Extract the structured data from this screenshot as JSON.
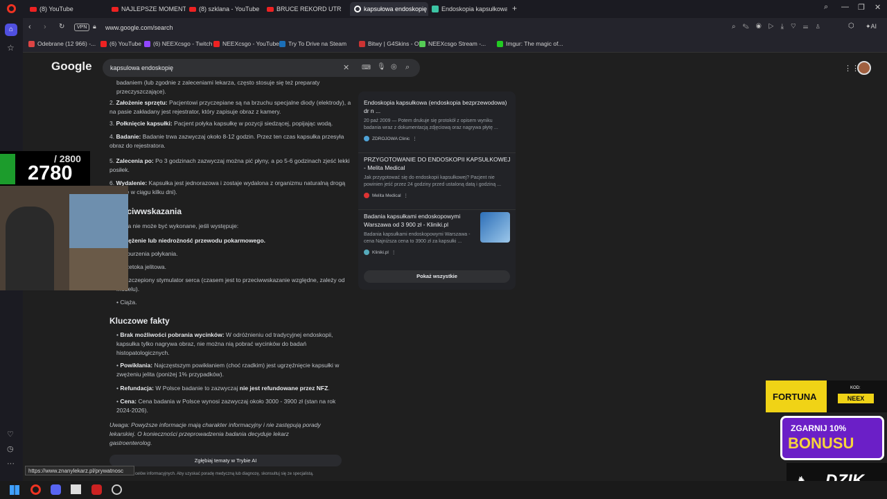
{
  "tabs": [
    {
      "label": "(8) YouTube",
      "icon": "youtube-icon"
    },
    {
      "label": "NAJLEPSZE MOMENTY PO",
      "icon": "youtube-icon"
    },
    {
      "label": "(8) szklana - YouTube",
      "icon": "youtube-icon"
    },
    {
      "label": "BRUCE REKORD UTRATY W",
      "icon": "youtube-icon"
    },
    {
      "label": "kapsułowa endoskopię - S",
      "icon": "google-icon"
    },
    {
      "label": "Endoskopia kapsułkowa -",
      "icon": "page-icon"
    }
  ],
  "address": {
    "url": "www.google.com/search",
    "vpn": "VPN",
    "ai_label": "AI"
  },
  "bookmarks": [
    {
      "label": "Odebrane (12 966) -...",
      "color": "#d44"
    },
    {
      "label": "(6) YouTube",
      "color": "#e22"
    },
    {
      "label": "(6) NEEXcsgo - Twitch",
      "color": "#9146ff"
    },
    {
      "label": "NEEXcsgo - YouTube",
      "color": "#e22"
    },
    {
      "label": "Try To Drive na Steam",
      "color": "#1b6fb8"
    },
    {
      "label": "Bitwy | G4Skins - Ot...",
      "color": "#c33"
    },
    {
      "label": "NEEXcsgo Stream -...",
      "color": "#5c5"
    },
    {
      "label": "Imgur: The magic of...",
      "color": "#2c2"
    }
  ],
  "search": {
    "query": "kapsulowa endoskopię",
    "logo": "Google"
  },
  "article": {
    "intro": "badaniem (lub zgodnie z zaleceniami lekarza, często stosuje się też preparaty przeczyszczające).",
    "steps": [
      {
        "num": "2.",
        "bold": "Założenie sprzętu:",
        "text": " Pacjentowi przyczepiane są na brzuchu specjalne diody (elektrody), a na pasie zakładany jest rejestrator, który zapisuje obraz z kamery."
      },
      {
        "num": "3.",
        "bold": "Połknięcie kapsułki:",
        "text": " Pacjent połyka kapsułkę w pozycji siedzącej, popijając wodą."
      },
      {
        "num": "4.",
        "bold": "Badanie:",
        "text": " Badanie trwa zazwyczaj około 8-12 godzin. Przez ten czas kapsułka przesyła obraz do rejestratora."
      },
      {
        "num": "5.",
        "bold": "Zalecenia po:",
        "text": " Po 3 godzinach zazwyczaj można pić płyny, a po 5-6 godzinach zjeść lekki posiłek."
      },
      {
        "num": "6.",
        "bold": "Wydalenie:",
        "text": " Kapsułka jest jednorazowa i zostaje wydalona z organizmu naturalną drogą (zwykle w ciągu kilku dni)."
      }
    ],
    "contra_heading": "Przeciwwskazania",
    "contra_intro": "Badania nie może być wykonane, jeśli występuje:",
    "contra_items": [
      {
        "bold": "Zwężenie lub niedrożność przewodu pokarmowego.",
        "text": ""
      },
      {
        "bold": "",
        "text": "Zaburzenia połykania."
      },
      {
        "bold": "",
        "text": "Przetoka jelitowa."
      },
      {
        "bold": "",
        "text": "Wszczepiony stymulator serca (czasem jest to przeciwwskazanie względne, zależy od modelu)."
      },
      {
        "bold": "",
        "text": "Ciąża."
      }
    ],
    "facts_heading": "Kluczowe fakty",
    "facts": [
      {
        "bold": "Brak możliwości pobrania wycinków:",
        "text": " W odróżnieniu od tradycyjnej endoskopii, kapsułka tylko nagrywa obraz, nie można nią pobrać wycinków do badań histopatologicznych."
      },
      {
        "bold": "Powikłania:",
        "text": " Najczęstszym powikłaniem (choć rzadkim) jest ugrzęźnięcie kapsułki w zwężeniu jelita (poniżej 1% przypadków)."
      },
      {
        "bold": "Refundacja:",
        "text": " W Polsce badanie to zazwyczaj ",
        "bold2": "nie jest refundowane przez NFZ",
        "text2": "."
      },
      {
        "bold": "Cena:",
        "text": " Cena badania w Polsce wynosi zazwyczaj około 3000 - 3900 zł (stan na rok 2024-2026)."
      }
    ],
    "note": "Uwaga: Powyższe informacje mają charakter informacyjny i nie zastępują porady lekarskiej. O konieczności przeprowadzenia badania decyduje lekarz gastroenterolog.",
    "ai_button": "Zgłębiaj tematy w Trybie AI",
    "footer": "celów informacyjnych. Aby uzyskać poradę medyczną lub diagnozę, skonsultuj się ze specjalistą."
  },
  "sources": [
    {
      "title": "Endoskopia kapsułkowa (endoskopia bezprzewodowa) dr n ...",
      "snippet": "20 paź 2009 — Potem drukuje się protokół z opisem wyniku badania wraz z dokumentacją zdjęciową oraz nagrywa płytę ...",
      "site": "ZDROJOWA Clinic",
      "color": "#4fa3d8"
    },
    {
      "title": "PRZYGOTOWANIE DO ENDOSKOPII KAPSUŁKOWEJ - Melita Medical",
      "snippet": "Jak przygotować się do endoskopii kapsułkowej? Pacjent nie powinien jeść przez 24 godziny przed ustaloną datą i godziną ...",
      "site": "Melita Medical",
      "color": "#d33"
    },
    {
      "title": "Badania kapsułkami endoskopowymi Warszawa od 3 900 zł - Kliniki.pl",
      "snippet": "Badania kapsułkami endoskopowymi Warszawa - cena Najniższa cena to 3900 zł za kapsułki ...",
      "site": "Kliniki.pl",
      "color": "#5ab"
    }
  ],
  "show_all": "Pokaż wszystkie",
  "status_url": "https://www.znanylekarz.pl/prywatnosc",
  "overlay": {
    "counter_total": "/ 2800",
    "counter_value": "2780",
    "fortuna": "FORTUNA",
    "kod_label": "KOD:",
    "kod_value": "NEEX",
    "bonus_line1": "ZGARNIJ 10%",
    "bonus_line2": "BONUSU",
    "dzik": "DZIK"
  }
}
